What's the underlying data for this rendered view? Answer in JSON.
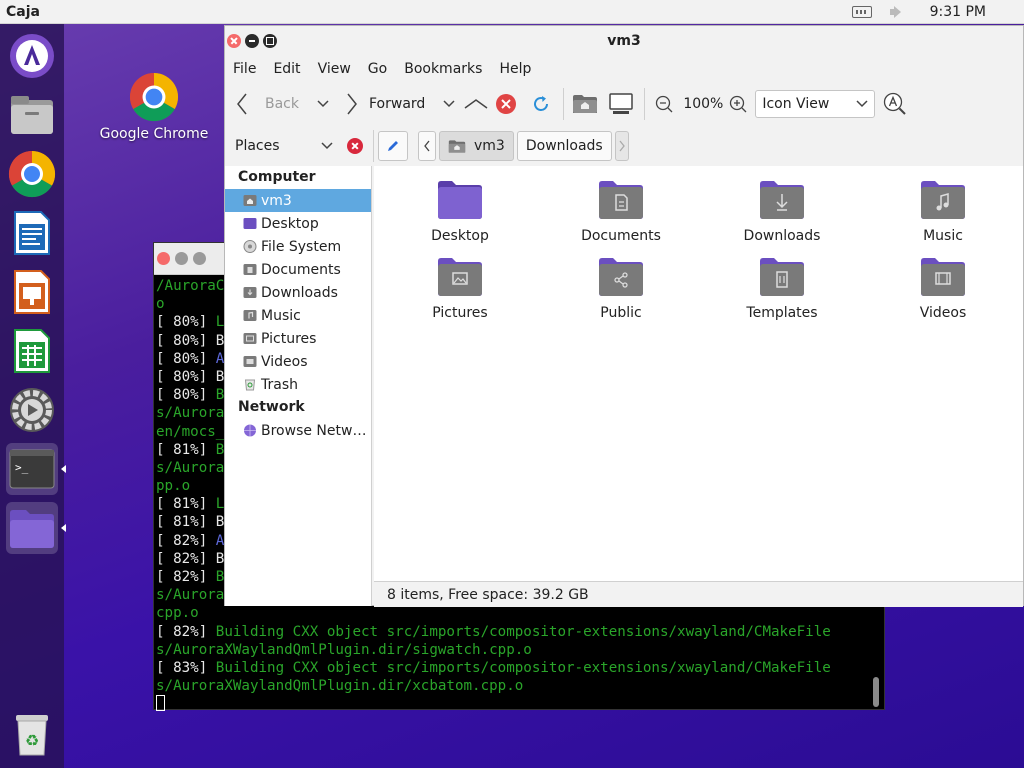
{
  "topbar": {
    "app_name": "Caja",
    "clock": "9:31 PM"
  },
  "dock": {
    "items": [
      "aurora-app-icon",
      "files-icon",
      "chrome-icon",
      "writer-icon",
      "impress-icon",
      "calc-icon",
      "settings-icon",
      "terminal-icon",
      "folder-icon",
      "trash-icon"
    ]
  },
  "desktop": {
    "chrome_label": "Google Chrome"
  },
  "terminal": {
    "lines": [
      [
        {
          "t": "/AuroraC",
          "c": "g"
        }
      ],
      [
        {
          "t": "o",
          "c": "g"
        }
      ],
      [
        {
          "t": "[ 80%] ",
          "c": "w"
        },
        {
          "t": "L",
          "c": "g"
        }
      ],
      [
        {
          "t": "[ 80%] ",
          "c": "w"
        },
        {
          "t": "B",
          "c": "w"
        }
      ],
      [
        {
          "t": "[ 80%] ",
          "c": "w"
        },
        {
          "t": "A",
          "c": "b"
        }
      ],
      [
        {
          "t": "[ 80%] ",
          "c": "w"
        },
        {
          "t": "B",
          "c": "w"
        }
      ],
      [
        {
          "t": "[ 80%] ",
          "c": "w"
        },
        {
          "t": "B",
          "c": "g"
        }
      ],
      [
        {
          "t": "s/Aurora",
          "c": "g"
        }
      ],
      [
        {
          "t": "en/mocs_",
          "c": "g"
        }
      ],
      [
        {
          "t": "[ 81%] ",
          "c": "w"
        },
        {
          "t": "B",
          "c": "g"
        }
      ],
      [
        {
          "t": "s/Aurora",
          "c": "g"
        }
      ],
      [
        {
          "t": "pp.o",
          "c": "g"
        }
      ],
      [
        {
          "t": "[ 81%] ",
          "c": "w"
        },
        {
          "t": "L",
          "c": "g"
        }
      ],
      [
        {
          "t": "[ 81%] ",
          "c": "w"
        },
        {
          "t": "B",
          "c": "w"
        }
      ],
      [
        {
          "t": "[ 82%] ",
          "c": "w"
        },
        {
          "t": "A",
          "c": "b"
        }
      ],
      [
        {
          "t": "[ 82%] ",
          "c": "w"
        },
        {
          "t": "B",
          "c": "w"
        }
      ],
      [
        {
          "t": "[ 82%] ",
          "c": "w"
        },
        {
          "t": "B",
          "c": "g"
        }
      ],
      [
        {
          "t": "s/Aurora",
          "c": "g"
        }
      ],
      [
        {
          "t": "cpp.o",
          "c": "g"
        }
      ],
      [
        {
          "t": "[ 82%] ",
          "c": "w"
        },
        {
          "t": "Building CXX object src/imports/compositor-extensions/xwayland/CMakeFile",
          "c": "g"
        }
      ],
      [
        {
          "t": "s/AuroraXWaylandQmlPlugin.dir/sigwatch.cpp.o",
          "c": "g"
        }
      ],
      [
        {
          "t": "[ 83%] ",
          "c": "w"
        },
        {
          "t": "Building CXX object src/imports/compositor-extensions/xwayland/CMakeFile",
          "c": "g"
        }
      ],
      [
        {
          "t": "s/AuroraXWaylandQmlPlugin.dir/xcbatom.cpp.o",
          "c": "g"
        }
      ]
    ]
  },
  "caja": {
    "title": "vm3",
    "menu": [
      "File",
      "Edit",
      "View",
      "Go",
      "Bookmarks",
      "Help"
    ],
    "toolbar": {
      "back": "Back",
      "forward": "Forward",
      "zoom": "100%",
      "view_mode": "Icon View"
    },
    "places_label": "Places",
    "path": [
      "vm3",
      "Downloads"
    ],
    "sidebar": {
      "computer_heading": "Computer",
      "computer_items": [
        "vm3",
        "Desktop",
        "File System",
        "Documents",
        "Downloads",
        "Music",
        "Pictures",
        "Videos",
        "Trash"
      ],
      "network_heading": "Network",
      "network_items": [
        "Browse Netw…"
      ]
    },
    "files": [
      "Desktop",
      "Documents",
      "Downloads",
      "Music",
      "Pictures",
      "Public",
      "Templates",
      "Videos"
    ],
    "status": "8 items, Free space: 39.2 GB"
  },
  "colors": {
    "folder_top": "#8f8f8f",
    "folder_body": "#6e6e6e",
    "folder_accent": "#6b4fc0",
    "selection": "#5fa8e0",
    "reload_blue": "#2a8fd8",
    "stop_red": "#e04444"
  }
}
